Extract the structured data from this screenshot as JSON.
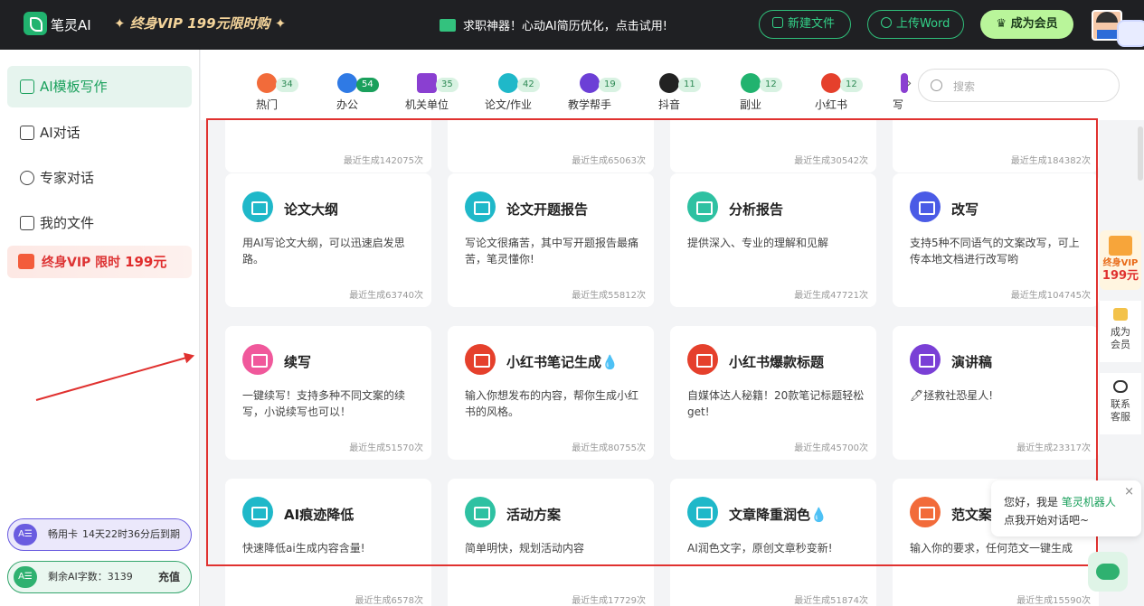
{
  "topbar": {
    "brand": "笔灵AI",
    "vip_banner": "✦ 终身VIP 199元限时购 ✦",
    "notice": "求职神器！心动AI简历优化，点击试用!",
    "new_file": "新建文件",
    "upload_word": "上传Word",
    "become_member": "成为会员"
  },
  "sidebar": {
    "items": [
      {
        "label": "AI模板写作",
        "icon": "template-write-icon"
      },
      {
        "label": "AI对话",
        "icon": "chat-icon"
      },
      {
        "label": "专家对话",
        "icon": "expert-icon"
      },
      {
        "label": "我的文件",
        "icon": "file-icon"
      }
    ],
    "vip_label": "终身VIP 限时 ",
    "vip_price": "199元",
    "card1_name": "畅用卡",
    "card1_status": "14天22时36分后到期",
    "card2_label": "剩余AI字数：3139",
    "card2_action": "充值",
    "pill_icon_text": "A☰"
  },
  "categories": [
    {
      "label": "热门",
      "badge": "34",
      "color": "#f26b3a"
    },
    {
      "label": "办公",
      "badge": "54",
      "color": "#2f7ae5"
    },
    {
      "label": "机关单位",
      "badge": "35",
      "color": "#8a3fd1"
    },
    {
      "label": "论文/作业",
      "badge": "42",
      "color": "#1fb8c9"
    },
    {
      "label": "教学帮手",
      "badge": "19",
      "color": "#6c3fd6"
    },
    {
      "label": "抖音",
      "badge": "11",
      "color": "#222222"
    },
    {
      "label": "副业",
      "badge": "12",
      "color": "#21b36f"
    },
    {
      "label": "小红书",
      "badge": "12",
      "color": "#e5402c"
    },
    {
      "label": "写",
      "badge": "",
      "color": "#8a3fd1"
    }
  ],
  "search": {
    "placeholder": "搜索"
  },
  "cards": [
    {
      "title": "",
      "desc": "",
      "stat": "最近生成142075次",
      "color": "#ffffff"
    },
    {
      "title": "",
      "desc": "",
      "stat": "最近生成65063次",
      "color": "#ffffff"
    },
    {
      "title": "",
      "desc": "",
      "stat": "最近生成30542次",
      "color": "#ffffff"
    },
    {
      "title": "",
      "desc": "",
      "stat": "最近生成184382次",
      "color": "#ffffff"
    },
    {
      "title": "论文大纲",
      "desc": "用AI写论文大纲，可以迅速启发思路。",
      "stat": "最近生成63740次",
      "color": "#1fb8c9"
    },
    {
      "title": "论文开题报告",
      "desc": "写论文很痛苦，其中写开题报告最痛苦，笔灵懂你!",
      "stat": "最近生成55812次",
      "color": "#1fb8c9"
    },
    {
      "title": "分析报告",
      "desc": "提供深入、专业的理解和见解",
      "stat": "最近生成47721次",
      "color": "#2ec1a2"
    },
    {
      "title": "改写",
      "desc": "支持5种不同语气的文案改写，可上传本地文档进行改写哟",
      "stat": "最近生成104745次",
      "color": "#4a5be6"
    },
    {
      "title": "续写",
      "desc": "一键续写！支持多种不同文案的续写，小说续写也可以！",
      "stat": "最近生成51570次",
      "color": "#f0589b"
    },
    {
      "title": "小红书笔记生成💧",
      "desc": "输入你想发布的内容，帮你生成小红书的风格。",
      "stat": "最近生成80755次",
      "color": "#e5402c"
    },
    {
      "title": "小红书爆款标题",
      "desc": "自媒体达人秘籍！20款笔记标题轻松get!",
      "stat": "最近生成45700次",
      "color": "#e5402c"
    },
    {
      "title": "演讲稿",
      "desc": "🖊拯救社恐星人!",
      "stat": "最近生成23317次",
      "color": "#7a3fd6"
    },
    {
      "title": "AI痕迹降低",
      "desc": "快速降低ai生成内容含量!",
      "stat": "最近生成6578次",
      "color": "#1fb8c9"
    },
    {
      "title": "活动方案",
      "desc": "简单明快，规划活动内容",
      "stat": "最近生成17729次",
      "color": "#2ec1a2"
    },
    {
      "title": "文章降重润色💧",
      "desc": "AI润色文字，原创文章秒变新!",
      "stat": "最近生成51874次",
      "color": "#1fb8c9"
    },
    {
      "title": "范文案",
      "desc": "输入你的要求，任何范文一键生成",
      "stat": "最近生成15590次",
      "color": "#f26b3a"
    }
  ],
  "rightrail": {
    "vip_line1": "终身VIP",
    "vip_line2": "199元",
    "member": "成为会员",
    "contact": "联系客服"
  },
  "chat": {
    "greeting_prefix": "您好，我是 ",
    "bot_name": "笔灵机器人",
    "line2": "点我开始对话吧~",
    "close": "×"
  }
}
